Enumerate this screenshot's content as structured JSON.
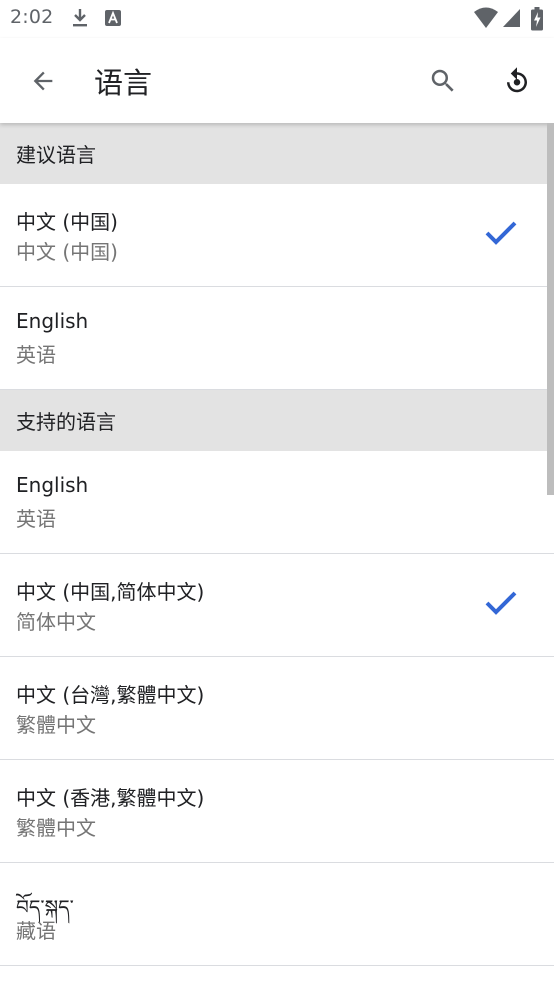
{
  "status_bar": {
    "time": "2:02",
    "icons": [
      "download-icon",
      "text-a-icon",
      "wifi-icon",
      "cellular-icon",
      "battery-charging-icon"
    ]
  },
  "app_bar": {
    "title": "语言",
    "back_icon": "arrow-back-icon",
    "search_icon": "search-icon",
    "reset_icon": "restore-icon"
  },
  "colors": {
    "accent": "#3367d6",
    "section_bg": "#e3e3e3",
    "secondary_text": "#757575"
  },
  "sections": [
    {
      "header": "建议语言",
      "items": [
        {
          "primary": "中文 (中国)",
          "secondary": "中文 (中国)",
          "selected": true
        },
        {
          "primary": "English",
          "secondary": "英语",
          "selected": false
        }
      ]
    },
    {
      "header": "支持的语言",
      "items": [
        {
          "primary": "English",
          "secondary": "英语",
          "selected": false
        },
        {
          "primary": "中文 (中国,简体中文)",
          "secondary": "简体中文",
          "selected": true
        },
        {
          "primary": "中文 (台灣,繁體中文)",
          "secondary": "繁體中文",
          "selected": false
        },
        {
          "primary": "中文 (香港,繁體中文)",
          "secondary": "繁體中文",
          "selected": false
        },
        {
          "primary": "བོད་སྐད་",
          "secondary": "藏语",
          "selected": false
        }
      ]
    }
  ]
}
